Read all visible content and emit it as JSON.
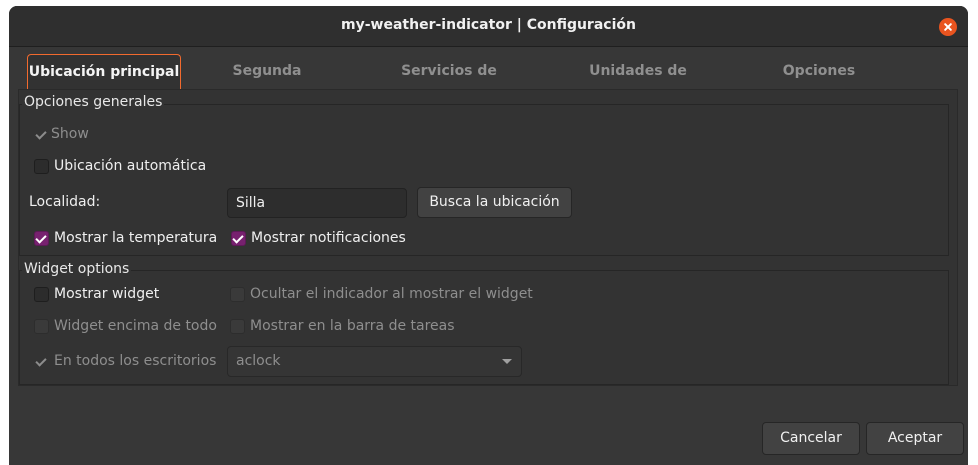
{
  "window": {
    "title": "my-weather-indicator | Configuración"
  },
  "icons": {
    "close": "close-icon",
    "check": "checkmark-icon",
    "dropdown": "chevron-down-icon"
  },
  "colors": {
    "accent": "#f26a2e",
    "checkbox_checked": "#77216f",
    "close_button": "#e9541f"
  },
  "tabs": [
    {
      "label": "Ubicación principal",
      "active": true
    },
    {
      "label": "Segunda ubicación",
      "active": false
    },
    {
      "label": "Servicios de pronóstico",
      "active": false
    },
    {
      "label": "Unidades de medición",
      "active": false
    },
    {
      "label": "Opciones generales",
      "active": false
    }
  ],
  "general": {
    "title": "Opciones generales",
    "show_label": "Show",
    "show_checked": true,
    "auto_location_label": "Ubicación automática",
    "auto_location_checked": false,
    "locality_label": "Localidad:",
    "locality_value": "Silla",
    "search_button": "Busca la ubicación",
    "show_temperature_label": "Mostrar la temperatura",
    "show_temperature_checked": true,
    "show_notifications_label": "Mostrar notificaciones",
    "show_notifications_checked": true
  },
  "widget": {
    "title": "Widget options",
    "show_widget_label": "Mostrar widget",
    "show_widget_checked": false,
    "hide_indicator_label": "Ocultar el indicador al mostrar el widget",
    "hide_indicator_checked": false,
    "on_top_label": "Widget encima de todo",
    "on_top_checked": false,
    "taskbar_label": "Mostrar en la barra de tareas",
    "taskbar_checked": false,
    "all_desktops_label": "En todos los escritorios",
    "all_desktops_checked": true,
    "skin_selected": "aclock"
  },
  "footer": {
    "cancel": "Cancelar",
    "accept": "Aceptar"
  }
}
